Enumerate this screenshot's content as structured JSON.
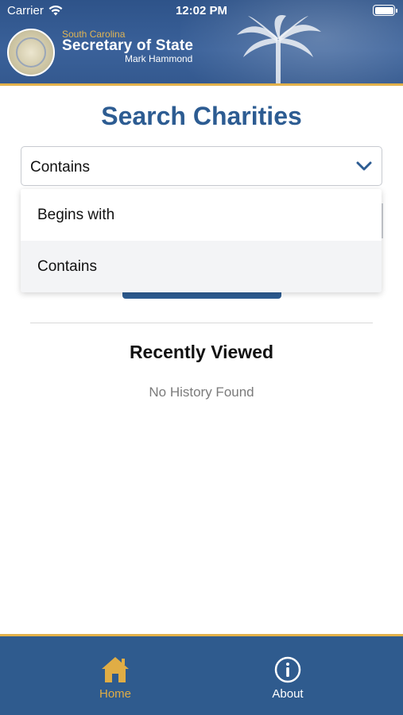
{
  "status_bar": {
    "carrier": "Carrier",
    "time": "12:02 PM",
    "battery_level": 1.0
  },
  "header": {
    "subtitle": "South Carolina",
    "title": "Secretary of State",
    "name": "Mark Hammond",
    "seal_icon": "state-seal-icon",
    "decor_icon": "palmetto-tree-icon"
  },
  "main": {
    "title": "Search Charities",
    "search_type": {
      "selected": "Contains",
      "options": [
        "Begins with",
        "Contains"
      ]
    },
    "recently_viewed": {
      "heading": "Recently Viewed",
      "empty_text": "No History Found"
    }
  },
  "tabbar": {
    "tabs": [
      {
        "label": "Home",
        "icon": "home-icon",
        "active": true
      },
      {
        "label": "About",
        "icon": "info-icon",
        "active": false
      }
    ]
  },
  "colors": {
    "brand_blue": "#2d5c92",
    "accent_gold": "#e2b14a",
    "active_tab": "#e0ad45"
  }
}
